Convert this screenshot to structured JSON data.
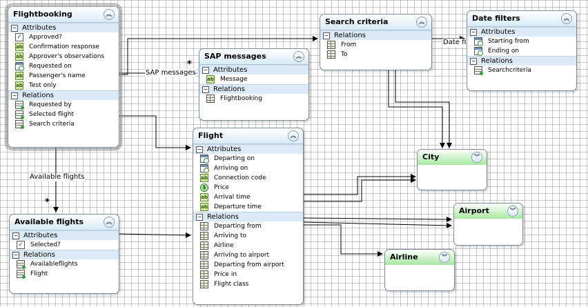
{
  "entities": {
    "flightbooking": {
      "title": "Flightbooking",
      "attributes_label": "Attributes",
      "attributes": [
        {
          "name": "Approved?",
          "icon": "checkbox-icon"
        },
        {
          "name": "Confirmation response",
          "icon": "text-field-icon"
        },
        {
          "name": "Approver's observations",
          "icon": "text-field-icon"
        },
        {
          "name": "Requested on",
          "icon": "date-icon"
        },
        {
          "name": "Passenger's name",
          "icon": "text-field-icon"
        },
        {
          "name": "Test only",
          "icon": "text-field-icon"
        }
      ],
      "relations_label": "Relations",
      "relations": [
        {
          "name": "Requested by",
          "icon": "list-relation-icon"
        },
        {
          "name": "Selected flight",
          "icon": "list-relation-icon"
        },
        {
          "name": "Search criteria",
          "icon": "list-relation-icon"
        }
      ]
    },
    "sap_messages": {
      "title": "SAP messages",
      "attributes_label": "Attributes",
      "attributes": [
        {
          "name": "Message",
          "icon": "text-field-icon"
        }
      ],
      "relations_label": "Relations",
      "relations": [
        {
          "name": "Flightbooking",
          "icon": "table-relation-icon"
        }
      ]
    },
    "search_criteria": {
      "title": "Search criteria",
      "relations_label": "Relations",
      "relations": [
        {
          "name": "From",
          "icon": "table-relation-icon"
        },
        {
          "name": "To",
          "icon": "table-relation-icon"
        }
      ]
    },
    "date_filters": {
      "title": "Date filters",
      "attributes_label": "Attributes",
      "attributes": [
        {
          "name": "Starting from",
          "icon": "date-icon"
        },
        {
          "name": "Ending on",
          "icon": "date-icon"
        }
      ],
      "relations_label": "Relations",
      "relations": [
        {
          "name": "Searchcriteria",
          "icon": "list-relation-icon"
        }
      ]
    },
    "flight": {
      "title": "Flight",
      "attributes_label": "Attributes",
      "attributes": [
        {
          "name": "Departing on",
          "icon": "date-icon"
        },
        {
          "name": "Arriving on",
          "icon": "date-icon"
        },
        {
          "name": "Connection code",
          "icon": "text-field-icon"
        },
        {
          "name": "Price",
          "icon": "money-icon"
        },
        {
          "name": "Arrival time",
          "icon": "text-field-icon"
        },
        {
          "name": "Departure time",
          "icon": "text-field-icon"
        }
      ],
      "relations_label": "Relations",
      "relations": [
        {
          "name": "Departing from",
          "icon": "table-relation-icon"
        },
        {
          "name": "Arriving to",
          "icon": "table-relation-icon"
        },
        {
          "name": "Airline",
          "icon": "table-relation-icon"
        },
        {
          "name": "Arriving to airport",
          "icon": "table-relation-icon"
        },
        {
          "name": "Departing from airport",
          "icon": "table-relation-icon"
        },
        {
          "name": "Price in",
          "icon": "table-relation-icon"
        },
        {
          "name": "Flight class",
          "icon": "table-relation-icon"
        }
      ]
    },
    "available_flights": {
      "title": "Available flights",
      "attributes_label": "Attributes",
      "attributes": [
        {
          "name": "Selected?",
          "icon": "checkbox-icon"
        }
      ],
      "relations_label": "Relations",
      "relations": [
        {
          "name": "Availableflights",
          "icon": "list-relation-icon"
        },
        {
          "name": "Flight",
          "icon": "list-relation-icon"
        }
      ]
    },
    "city": {
      "title": "City"
    },
    "airport": {
      "title": "Airport"
    },
    "airline": {
      "title": "Airline"
    }
  },
  "connector_labels": {
    "sap_messages": "SAP messages",
    "date_filters": "Date filters",
    "available_flights": "Available flights"
  },
  "multiplicity": "*",
  "colors": {
    "entity_header": "#d8ebf7",
    "lookup_header": "#a6e8a0",
    "section_band": "#dbeaf6",
    "grid": "#969696"
  }
}
